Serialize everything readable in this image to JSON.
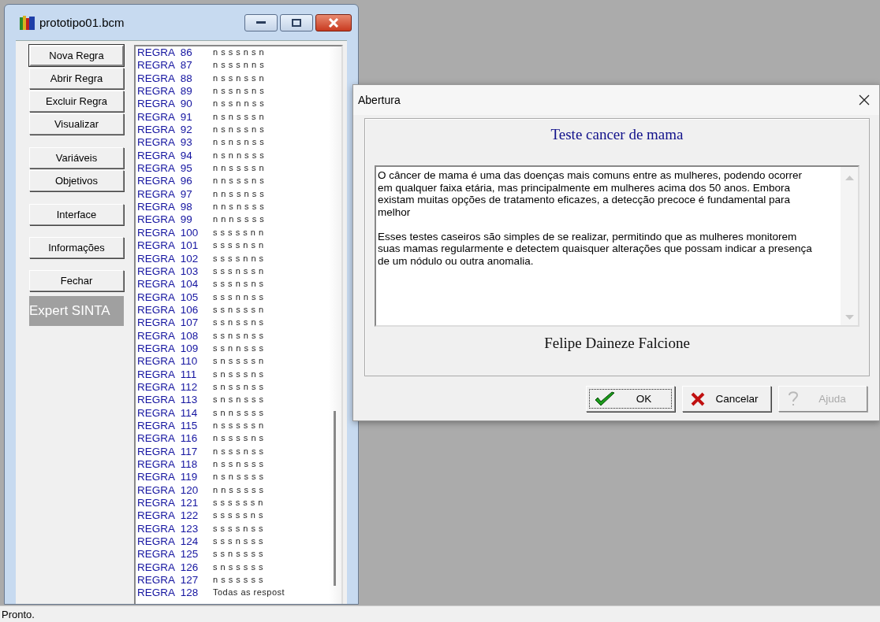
{
  "main_window": {
    "title": "prototipo01.bcm",
    "buttons": [
      {
        "label": "Nova Regra",
        "default": true
      },
      {
        "label": "Abrir Regra",
        "default": false
      },
      {
        "label": "Excluir Regra",
        "default": false
      },
      {
        "label": "Visualizar",
        "default": false
      },
      {
        "label": "Variáveis",
        "default": false
      },
      {
        "label": "Objetivos",
        "default": false
      },
      {
        "label": "Interface",
        "default": false
      },
      {
        "label": "Informações",
        "default": false
      },
      {
        "label": "Fechar",
        "default": false
      }
    ],
    "brand": "Expert SINTA",
    "rules": [
      {
        "rule": "REGRA  86",
        "answers": "n s s s n s n"
      },
      {
        "rule": "REGRA  87",
        "answers": "n s s s n n s"
      },
      {
        "rule": "REGRA  88",
        "answers": "n s s n s s n"
      },
      {
        "rule": "REGRA  89",
        "answers": "n s s n s n s"
      },
      {
        "rule": "REGRA  90",
        "answers": "n s s n n s s"
      },
      {
        "rule": "REGRA  91",
        "answers": "n s n s s s n"
      },
      {
        "rule": "REGRA  92",
        "answers": "n s n s s n s"
      },
      {
        "rule": "REGRA  93",
        "answers": "n s n s n s s"
      },
      {
        "rule": "REGRA  94",
        "answers": "n s n n s s s"
      },
      {
        "rule": "REGRA  95",
        "answers": "n n s s s s n"
      },
      {
        "rule": "REGRA  96",
        "answers": "n n s s s n s"
      },
      {
        "rule": "REGRA  97",
        "answers": "n n s s n s s"
      },
      {
        "rule": "REGRA  98",
        "answers": "n n s n s s s"
      },
      {
        "rule": "REGRA  99",
        "answers": "n n n s s s s"
      },
      {
        "rule": "REGRA  100",
        "answers": "s s s s s n n"
      },
      {
        "rule": "REGRA  101",
        "answers": "s s s s n s n"
      },
      {
        "rule": "REGRA  102",
        "answers": "s s s s n n s"
      },
      {
        "rule": "REGRA  103",
        "answers": "s s s n s s n"
      },
      {
        "rule": "REGRA  104",
        "answers": "s s s n s n s"
      },
      {
        "rule": "REGRA  105",
        "answers": "s s s n n s s"
      },
      {
        "rule": "REGRA  106",
        "answers": "s s n s s s n"
      },
      {
        "rule": "REGRA  107",
        "answers": "s s n s s n s"
      },
      {
        "rule": "REGRA  108",
        "answers": "s s n s n s s"
      },
      {
        "rule": "REGRA  109",
        "answers": "s s n n s s s"
      },
      {
        "rule": "REGRA  110",
        "answers": "s n s s s s n"
      },
      {
        "rule": "REGRA  111",
        "answers": "s n s s s n s"
      },
      {
        "rule": "REGRA  112",
        "answers": "s n s s n s s"
      },
      {
        "rule": "REGRA  113",
        "answers": "s n s n s s s"
      },
      {
        "rule": "REGRA  114",
        "answers": "s n n s s s s"
      },
      {
        "rule": "REGRA  115",
        "answers": "n s s s s s n"
      },
      {
        "rule": "REGRA  116",
        "answers": "n s s s s n s"
      },
      {
        "rule": "REGRA  117",
        "answers": "n s s s n s s"
      },
      {
        "rule": "REGRA  118",
        "answers": "n s s n s s s"
      },
      {
        "rule": "REGRA  119",
        "answers": "n s n s s s s"
      },
      {
        "rule": "REGRA  120",
        "answers": "n n s s s s s"
      },
      {
        "rule": "REGRA  121",
        "answers": "s s s s s s n"
      },
      {
        "rule": "REGRA  122",
        "answers": "s s s s s n s"
      },
      {
        "rule": "REGRA  123",
        "answers": "s s s s n s s"
      },
      {
        "rule": "REGRA  124",
        "answers": "s s s n s s s"
      },
      {
        "rule": "REGRA  125",
        "answers": "s s n s s s s"
      },
      {
        "rule": "REGRA  126",
        "answers": "s n s s s s s"
      },
      {
        "rule": "REGRA  127",
        "answers": "n s s s s s s"
      },
      {
        "rule": "REGRA  128",
        "answers": "Todas as respost"
      }
    ]
  },
  "dialog": {
    "title": "Abertura",
    "heading": "Teste cancer de mama",
    "paragraphs": [
      "O câncer de mama é uma das doenças mais comuns entre as mulheres, podendo ocorrer em qualquer faixa etária, mas principalmente em mulheres acima dos 50 anos. Embora existam muitas opções de tratamento eficazes, a detecção precoce é fundamental para melhor",
      "Esses testes caseiros são simples de se realizar, permitindo que as mulheres monitorem suas mamas regularmente e detectem quaisquer alterações que possam indicar a presença de um nódulo ou outra anomalia."
    ],
    "author": "Felipe Daineze Falcione",
    "buttons": [
      {
        "label": "OK",
        "kind": "ok",
        "focused": true,
        "disabled": false
      },
      {
        "label": "Cancelar",
        "kind": "cancel",
        "focused": false,
        "disabled": false
      },
      {
        "label": "Ajuda",
        "kind": "help",
        "focused": false,
        "disabled": true
      }
    ]
  },
  "status_bar": {
    "text": "Pronto."
  }
}
